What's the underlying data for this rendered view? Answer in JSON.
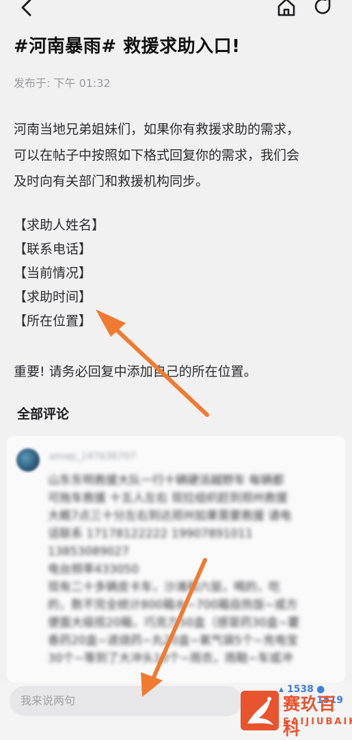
{
  "header": {
    "back_icon": "chevron-left-icon",
    "home_icon": "home-icon",
    "share_icon": "share-icon"
  },
  "post": {
    "title": "#河南暴雨# 救援求助入口!",
    "published": "发布于: 下午 01:32",
    "paragraphs": [
      "河南当地兄弟姐妹们，如果你有救援求助的需求，",
      "可以在帖子中按照如下格式回复你的需求，我们会",
      "及时向有关部门和救援机构同步。"
    ],
    "fields": [
      "【求助人姓名】",
      "【联系电话】",
      "【当前情况】",
      "【求助时间】",
      "【所在位置】"
    ],
    "important": "重要! 请务必回复中添加自己的所在位置。"
  },
  "comments": {
    "heading": "全部评论",
    "first": {
      "user": "amap_247636707",
      "lines": [
        "山东东明救援大队一行十辆硬派越野车 每辆都",
        "可拖车救援 十五人左右 现拉组织赶到郑州救援",
        "大概7点三十分左右到达郑州如果需要救援 请电",
        "话联系 17178122222   19907891011",
        "13853089027",
        "电台频率433050",
        "现有二十多辆皮卡车，沙滩和六驱，喝的，吃",
        "的，数不完全统计800箱水~700箱自热饭~或方",
        "便面大级揽20箱，巧克力50盒（感冒药30盒~藿",
        "香药20盒~退烧药~丸20盒~氧气袋5个~充电宝",
        "30个~等到了大冲头10个~雨衣，雨鞋~车或冲"
      ]
    }
  },
  "bottom_bar": {
    "input_placeholder": "我来说两句",
    "like_count": "1538",
    "comment_count": "1519"
  },
  "watermark": {
    "title": "赛玖百科",
    "subtitle": "SAIJIUBAIKE"
  },
  "colors": {
    "background": "#f1f1f2",
    "arrow": "#f07a30",
    "link_blue": "#3f7fd6",
    "watermark": "#e8542e"
  }
}
